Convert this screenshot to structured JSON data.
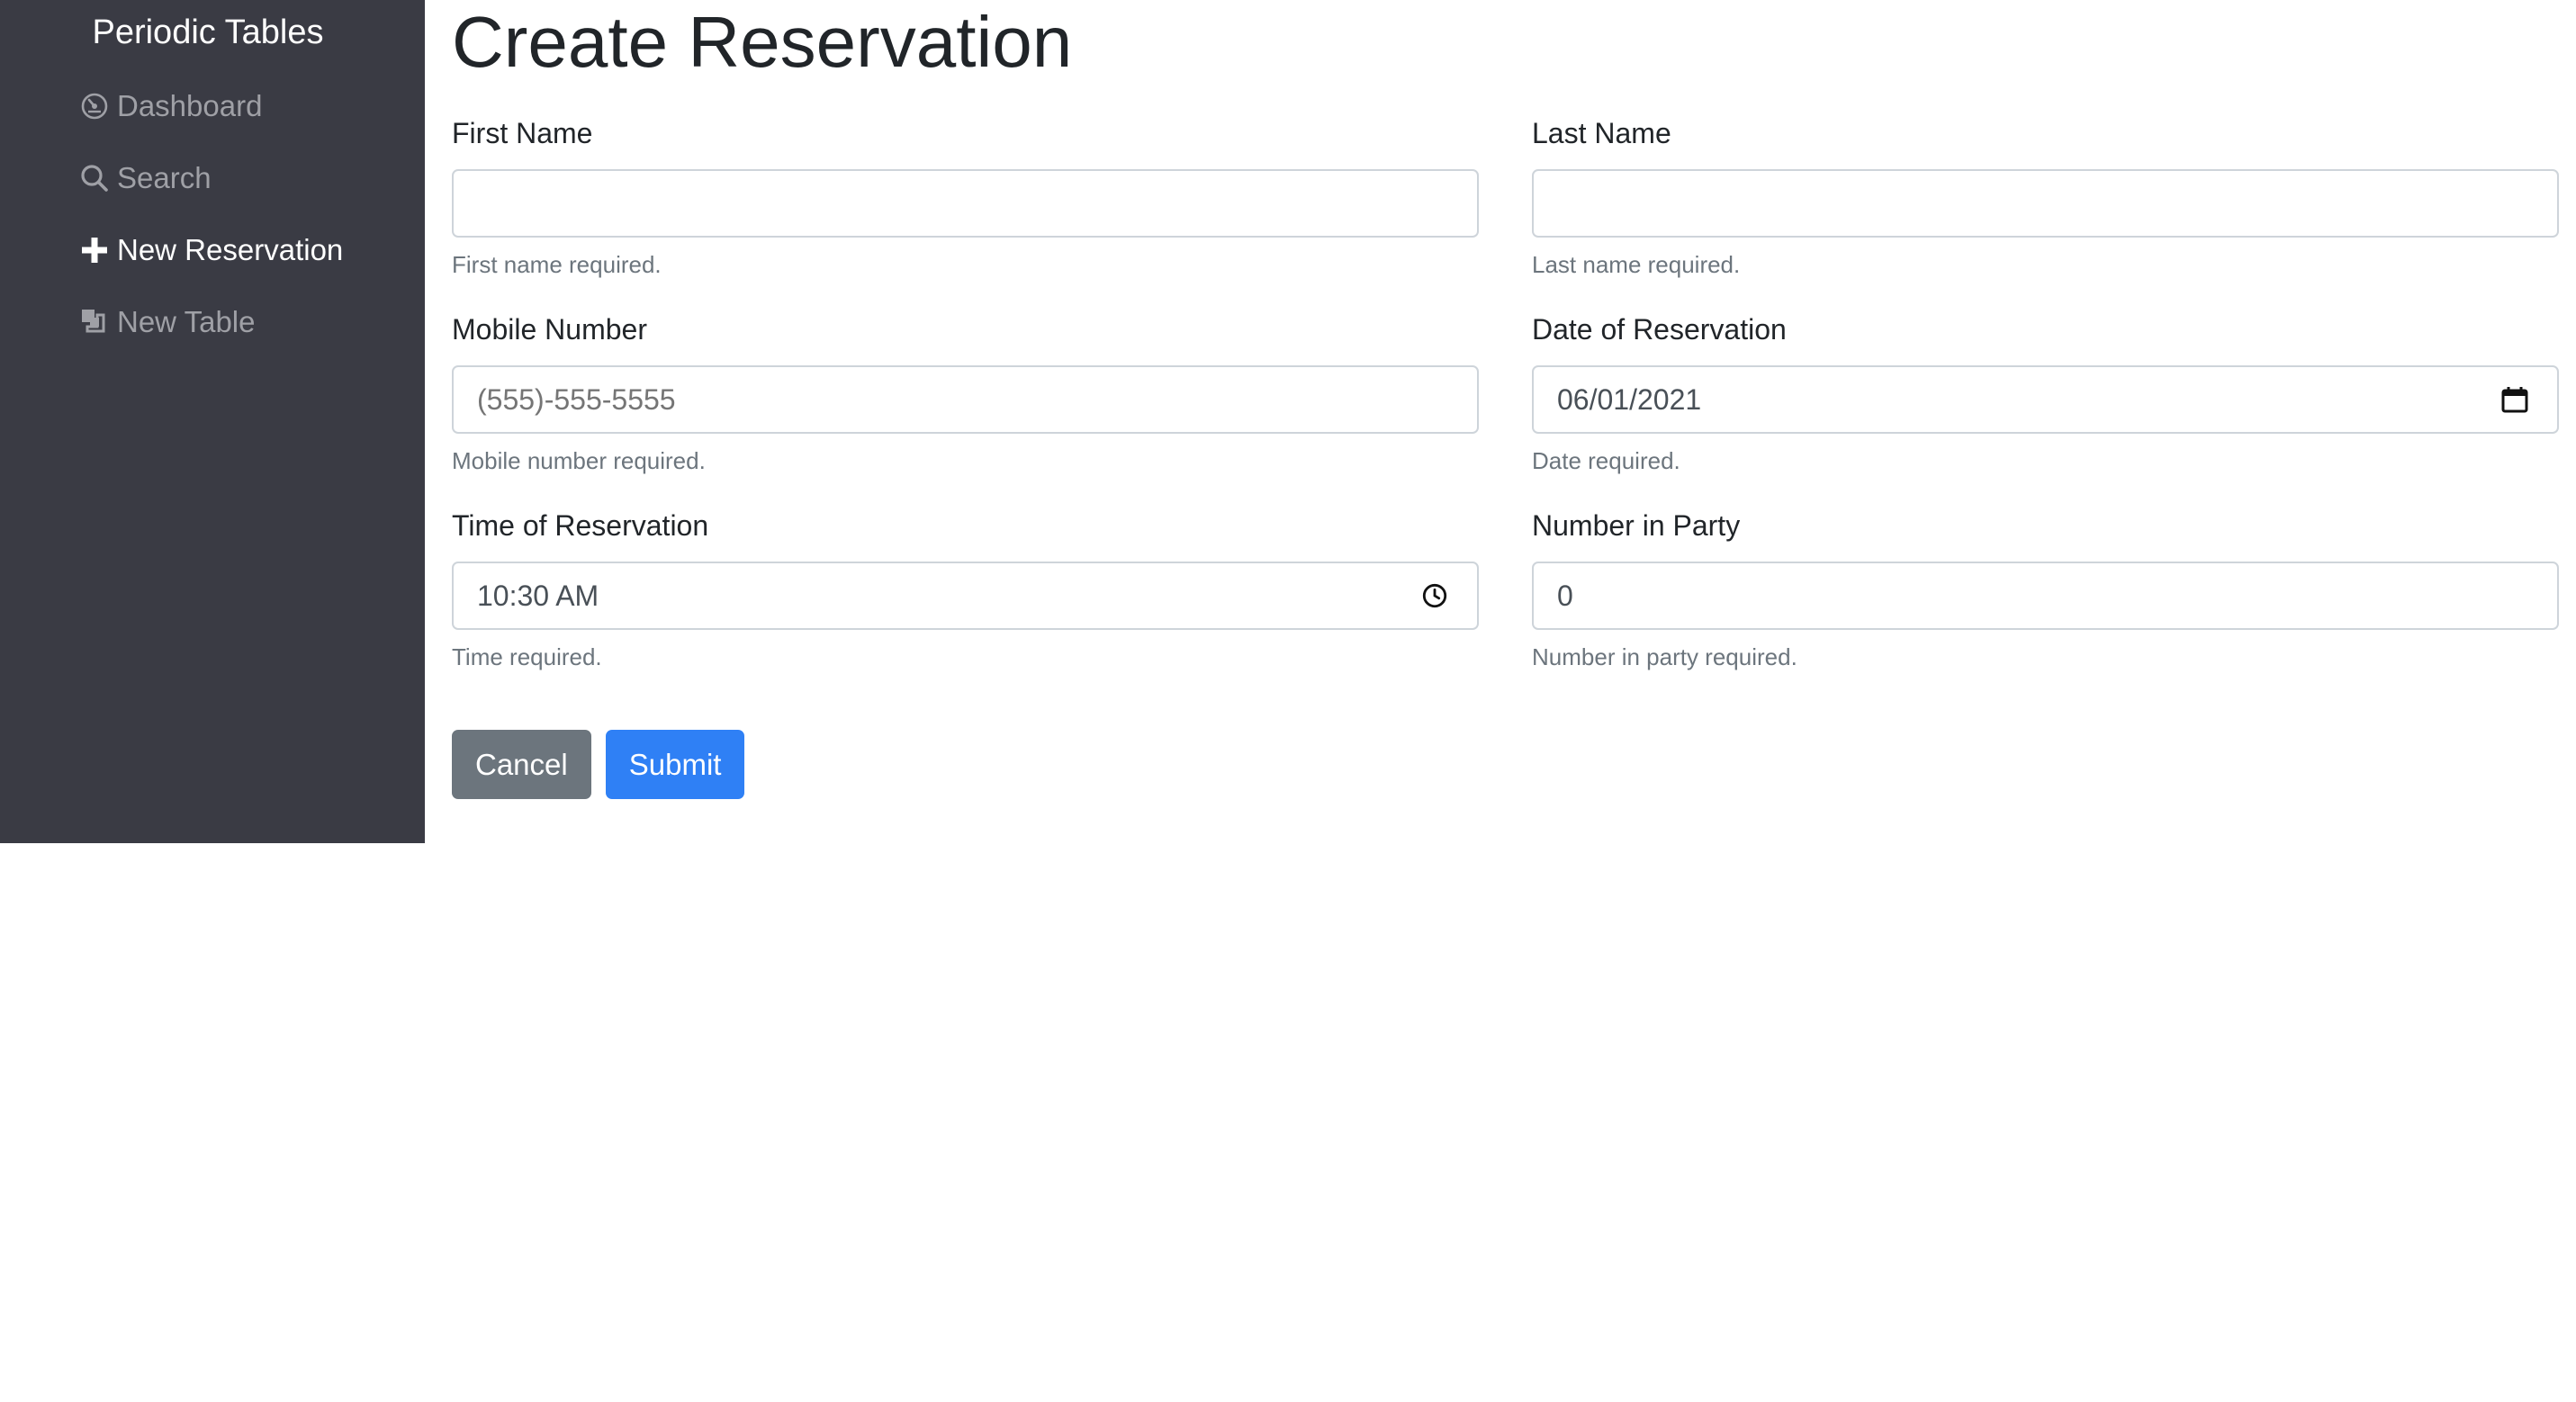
{
  "sidebar": {
    "brand": "Periodic Tables",
    "items": [
      {
        "label": "Dashboard",
        "icon": "dashboard-icon",
        "active": false
      },
      {
        "label": "Search",
        "icon": "search-icon",
        "active": false
      },
      {
        "label": "New Reservation",
        "icon": "plus-icon",
        "active": true
      },
      {
        "label": "New Table",
        "icon": "table-icon",
        "active": false
      }
    ],
    "background": "#3a3b44"
  },
  "main": {
    "title": "Create Reservation",
    "form": {
      "first_name": {
        "label": "First Name",
        "value": "",
        "help": "First name required."
      },
      "last_name": {
        "label": "Last Name",
        "value": "",
        "help": "Last name required."
      },
      "mobile_number": {
        "label": "Mobile Number",
        "value": "",
        "placeholder": "(555)-555-5555",
        "help": "Mobile number required."
      },
      "reservation_date": {
        "label": "Date of Reservation",
        "value": "06/01/2021",
        "icon": "calendar-icon",
        "help": "Date required."
      },
      "reservation_time": {
        "label": "Time of Reservation",
        "value": "10:30 AM",
        "icon": "clock-icon",
        "help": "Time required."
      },
      "people": {
        "label": "Number in Party",
        "value": "0",
        "help": "Number in party required."
      }
    },
    "buttons": {
      "cancel_label": "Cancel",
      "submit_label": "Submit"
    }
  },
  "colors": {
    "primary": "#2f80f5",
    "secondary": "#6c757d",
    "muted_text": "#6c757d"
  }
}
